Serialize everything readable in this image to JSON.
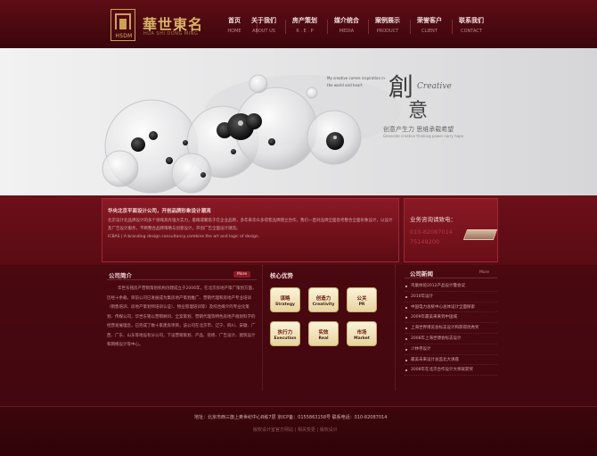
{
  "brand": {
    "name": "華世東名",
    "badge_text": "HSDM",
    "en_name": "HUA SHI DONG MING"
  },
  "nav": [
    {
      "cn": "首页",
      "en": "HOME"
    },
    {
      "cn": "关于我们",
      "en": "ABOUT US"
    },
    {
      "cn": "房产策划",
      "en": "R . E . P"
    },
    {
      "cn": "媒介统合",
      "en": "MEDIA"
    },
    {
      "cn": "案例展示",
      "en": "PRODUCT"
    },
    {
      "cn": "荣誉客户",
      "en": "CLIENT"
    },
    {
      "cn": "联系我们",
      "en": "CONTACT"
    }
  ],
  "banner": {
    "title_a": "創",
    "title_b": "意",
    "creative": "Creative",
    "slogan": "创意产生力  思维承载希望",
    "slogan_en": "Generate creative thinking power carry hope",
    "note": "My creative comes inspiration in the world and heart"
  },
  "intro": {
    "heading": "华央北京平面设计公司，开创品牌形象设计潮流",
    "body": "北京设计北品牌设计的多个领域具有强大实力，着眼或聚焦于在企业品牌，多年来华众多得客品牌建立合作，我们一直对品牌全面思考整合全面形象设计，以设计及广告设计服务，不断整合品牌策略与创意设计，开创广告全面设计潮流。",
    "body_en": "ICBAS | A branding design consultancy,combine the art and logic of design."
  },
  "hotline": {
    "label": "业务咨询请致电：",
    "numbers": [
      "010-82087014",
      "75149200"
    ]
  },
  "about": {
    "title": "公司简介",
    "more": "More",
    "text": "华世东铭房产营销策划机构创建成立于2006年，在北京房地产策广策划方面，历经十余载，目前公司已发展成为集房地产策划推广、营销代理和房地产专业培训（销售培训、房地产策划师培训认证）、物业管理培训等）及综合媒介的专业化策划、传媒公司，华世东铭以营销顾问、全案策划、营销代理等特色房地产规划科学的经营发展理念，已完成了数十家建房项目，该公司在北京市、辽宁、四川、安徽、广西、广东、山东等地设有分公司，下设营销策划、产品、装修、广告设计、建筑设计和网络设计等中心。"
  },
  "advantages": {
    "title": "核心优势",
    "items": [
      {
        "cn": "谋略",
        "en": "Strategy"
      },
      {
        "cn": "创造力",
        "en": "Creativity"
      },
      {
        "cn": "公关",
        "en": "PR"
      },
      {
        "cn": "执行力",
        "en": "Execution"
      },
      {
        "cn": "实效",
        "en": "Real"
      },
      {
        "cn": "市场",
        "en": "Market"
      }
    ]
  },
  "news": {
    "title": "公司新闻",
    "more": "More",
    "items": [
      "鸟巢体验2012产品设计暨会议",
      "2010年设计",
      "中国电力总统中心总体设计全面探索",
      "2009年最美来来到中国城",
      "上海世界博览会标志设计和获得优秀奖",
      "2008年上海世博会标志设计",
      "少林寺设计",
      "最美未来设计总监北大讲座",
      "2008年在北京合作设计大师就获奖"
    ]
  },
  "footer": {
    "info": "地址：北京市西三旗上奥世纪中心B栋7层    京ICP备：0155863158号    联系电话：010-82087014",
    "links": [
      "版权设计室官方网站",
      "相关变更",
      "版权设计"
    ]
  },
  "colors": {
    "header": "#4b0910",
    "accent_gold": "#d9b368",
    "content_bg": "#4a0810",
    "adv_button": "#f3e6b8"
  }
}
